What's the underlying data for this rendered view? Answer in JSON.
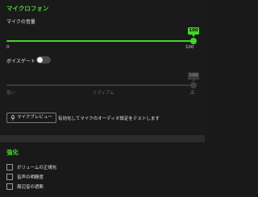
{
  "microphone": {
    "section_title": "マイクロフォン",
    "volume": {
      "label": "マイクの音量",
      "value": 100,
      "value_badge": "100",
      "min_label": "0",
      "max_label": "100"
    },
    "voice_gate": {
      "label": "ボイスゲート",
      "enabled": false,
      "level": 1.0,
      "value_badge": "100",
      "low_label": "低い",
      "mid_label": "ミディアム",
      "high_label": "高"
    },
    "preview": {
      "button_label": "マイクプレビュー",
      "description": "有効化してマイクのオーディオ設定をテストします"
    }
  },
  "enhancement": {
    "section_title": "強化",
    "options": [
      {
        "label": "ボリュームの正規化",
        "checked": false
      },
      {
        "label": "音声の明瞭度",
        "checked": false
      },
      {
        "label": "周辺音の遮断",
        "checked": false
      }
    ]
  },
  "colors": {
    "accent": "#44d62c",
    "background": "#1a1a1a",
    "divider": "#2b2b2b"
  }
}
